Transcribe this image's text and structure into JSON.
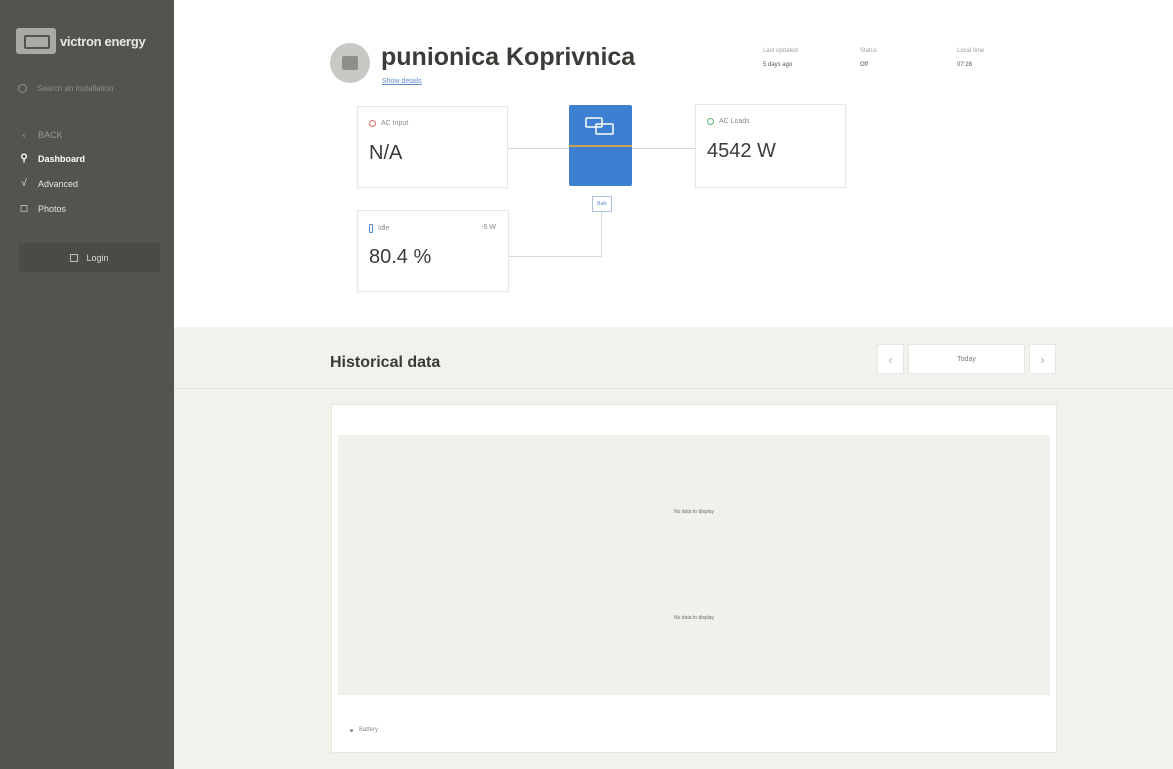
{
  "sidebar": {
    "brand": "victron energy",
    "search_placeholder": "Search an installation",
    "back_label": "BACK",
    "items": [
      {
        "label": "Dashboard",
        "icon": "dashboard-icon",
        "active": true
      },
      {
        "label": "Advanced",
        "icon": "chart-icon",
        "active": false
      },
      {
        "label": "Photos",
        "icon": "photo-icon",
        "active": false
      }
    ],
    "login_label": "Login"
  },
  "header": {
    "site_name": "punionica Koprivnica",
    "show_details": "Show details",
    "meta": [
      {
        "label": "Last updated",
        "value": "5 days ago"
      },
      {
        "label": "Status",
        "value": "Off"
      },
      {
        "label": "Local time",
        "value": "07:28"
      }
    ]
  },
  "flow": {
    "ac_input": {
      "label": "AC Input",
      "value": "N/A"
    },
    "ac_loads": {
      "label": "AC Loads",
      "value": "4542 W"
    },
    "battery": {
      "label": "Idle",
      "power": "-5 W",
      "value": "80.4 %"
    },
    "inverter_state": "Bulk"
  },
  "historical": {
    "title": "Historical data",
    "prev_icon": "chevron-left-icon",
    "next_icon": "chevron-right-icon",
    "range_label": "Today",
    "no_data_1": "No data to display",
    "no_data_2": "No data to display",
    "legend_label": "Battery"
  },
  "colors": {
    "sidebar": "#54544f",
    "accent_blue": "#3d7fd1",
    "band": "#f2f1ec"
  }
}
